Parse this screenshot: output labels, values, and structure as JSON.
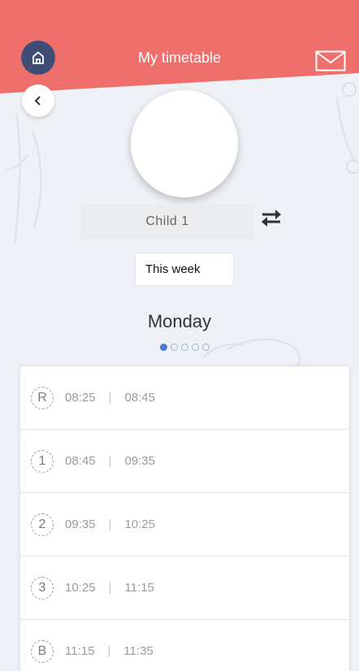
{
  "header": {
    "title": "My timetable",
    "color": "#ef6f6c"
  },
  "icons": {
    "home": "home-icon",
    "mail": "mail-icon",
    "back": "chevron-left-icon",
    "swap": "swap-arrows-icon"
  },
  "profile": {
    "child_name": "Child 1"
  },
  "week_selector": {
    "value": "This week"
  },
  "day": {
    "name": "Monday",
    "page_count": 5,
    "active_page": 1
  },
  "periods": [
    {
      "label": "R",
      "start": "08:25",
      "end": "08:45"
    },
    {
      "label": "1",
      "start": "08:45",
      "end": "09:35"
    },
    {
      "label": "2",
      "start": "09:35",
      "end": "10:25"
    },
    {
      "label": "3",
      "start": "10:25",
      "end": "11:15"
    },
    {
      "label": "B",
      "start": "11:15",
      "end": "11:35"
    }
  ]
}
